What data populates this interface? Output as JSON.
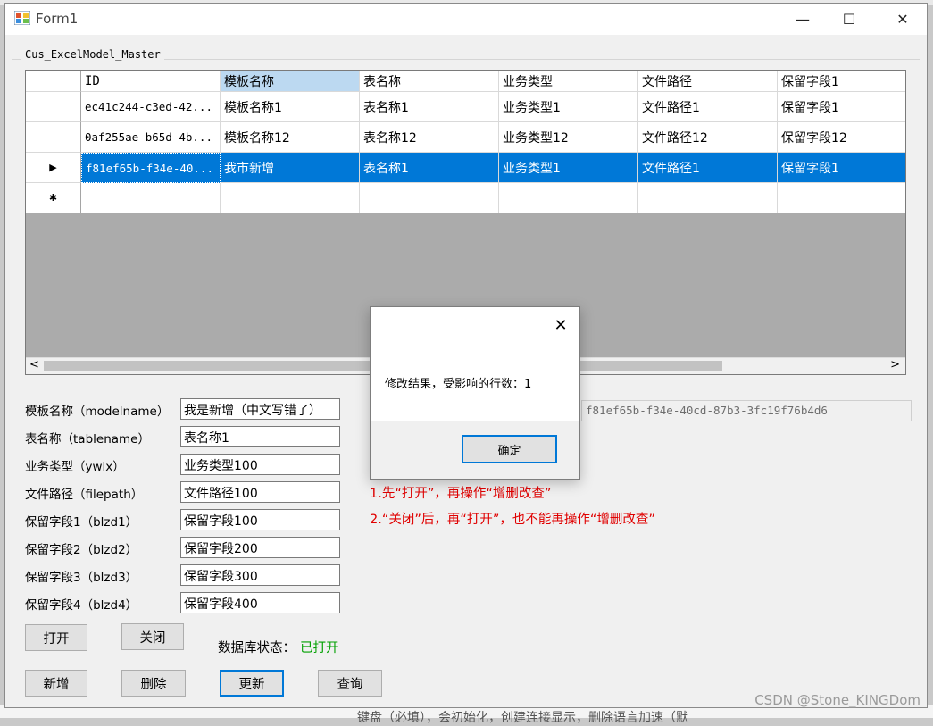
{
  "window": {
    "title": "Form1",
    "controls": {
      "minimize": "—",
      "maximize": "☐",
      "close": "✕"
    }
  },
  "group": {
    "label": "Cus_ExcelModel_Master"
  },
  "grid": {
    "columns": [
      "ID",
      "模板名称",
      "表名称",
      "业务类型",
      "文件路径",
      "保留字段1"
    ],
    "rows": [
      [
        "ec41c244-c3ed-42...",
        "模板名称1",
        "表名称1",
        "业务类型1",
        "文件路径1",
        "保留字段1"
      ],
      [
        "0af255ae-b65d-4b...",
        "模板名称12",
        "表名称12",
        "业务类型12",
        "文件路径12",
        "保留字段12"
      ],
      [
        "f81ef65b-f34e-40...",
        "我市新增",
        "表名称1",
        "业务类型1",
        "文件路径1",
        "保留字段1"
      ]
    ],
    "selected_row": 2,
    "current_row_marker": "▶",
    "new_row_marker": "✱",
    "scroll_left": "<",
    "scroll_right": ">"
  },
  "form": {
    "fields": [
      {
        "label": "模板名称（modelname）",
        "value": "我是新增（中文写错了）"
      },
      {
        "label": "表名称（tablename）",
        "value": "表名称1"
      },
      {
        "label": "业务类型（ywlx）",
        "value": "业务类型100"
      },
      {
        "label": "文件路径（filepath）",
        "value": "文件路径100"
      },
      {
        "label": "保留字段1（blzd1）",
        "value": "保留字段100"
      },
      {
        "label": "保留字段2（blzd2）",
        "value": "保留字段200"
      },
      {
        "label": "保留字段3（blzd3）",
        "value": "保留字段300"
      },
      {
        "label": "保留字段4（blzd4）",
        "value": "保留字段400"
      }
    ],
    "id_value": "f81ef65b-f34e-40cd-87b3-3fc19f76b4d6"
  },
  "notes": [
    "1.先“打开”，再操作“增删改查”",
    "2.“关闭”后，再“打开”，也不能再操作“增删改查”"
  ],
  "buttons": {
    "open": "打开",
    "close": "关闭",
    "add": "新增",
    "delete": "删除",
    "update": "更新",
    "query": "查询"
  },
  "status": {
    "label": "数据库状态：",
    "value": "已打开",
    "value_color": "#00a000"
  },
  "dialog": {
    "message": "修改结果，受影响的行数：1",
    "ok": "确定",
    "close": "✕"
  },
  "watermark": "CSDN @Stone_KINGDom",
  "background_text": "键盘（必填），会初始化，创建连接显示，删除语言加速（默"
}
